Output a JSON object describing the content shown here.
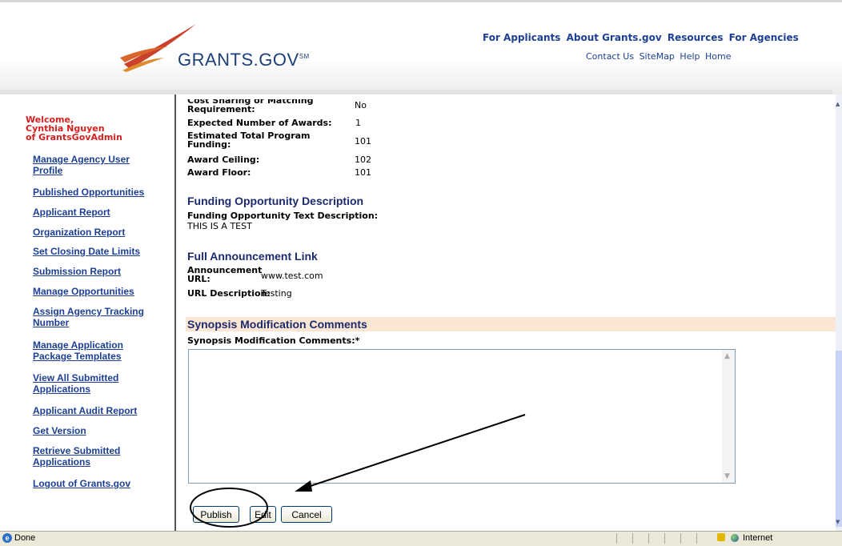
{
  "header": {
    "logo_text": "GRANTS.GOV",
    "logo_mark": "SM",
    "top_nav": [
      "For Applicants",
      "About Grants.gov",
      "Resources",
      "For Agencies"
    ],
    "sub_nav": [
      "Contact Us",
      "SiteMap",
      "Help",
      "Home"
    ]
  },
  "sidebar": {
    "welcome": [
      "Welcome,",
      "Cynthia Nguyen",
      "of GrantsGovAdmin"
    ],
    "links": [
      [
        "Manage Agency User",
        "Profile"
      ],
      [
        "Published Opportunities"
      ],
      [
        "Applicant Report"
      ],
      [
        "Organization Report"
      ],
      [
        "Set Closing Date Limits"
      ],
      [
        "Submission Report"
      ],
      [
        "Manage Opportunities"
      ],
      [
        "Assign Agency Tracking",
        "Number"
      ],
      [
        "Manage Application",
        "Package Templates"
      ],
      [
        "View All Submitted",
        "Applications"
      ],
      [
        "Applicant Audit Report"
      ],
      [
        "Get Version"
      ],
      [
        "Retrieve Submitted",
        "Applications"
      ],
      [
        "Logout of Grants.gov"
      ]
    ]
  },
  "funding": {
    "cost_sharing_label_1": "Cost Sharing or Matching",
    "cost_sharing_label_2": "Requirement:",
    "cost_sharing_value": "No",
    "expected_awards_label": "Expected Number of Awards:",
    "expected_awards_value": "1",
    "total_funding_label_1": "Estimated Total Program",
    "total_funding_label_2": "Funding:",
    "total_funding_value": "101",
    "award_ceiling_label": "Award Ceiling:",
    "award_ceiling_value": "102",
    "award_floor_label": "Award Floor:",
    "award_floor_value": "101"
  },
  "description": {
    "title": "Funding Opportunity Description",
    "text_label": "Funding Opportunity Text Description:",
    "text_value": "THIS IS A TEST"
  },
  "announcement": {
    "title": "Full Announcement Link",
    "url_label_1": "Announcement",
    "url_label_2": "URL:",
    "url_value": "www.test.com",
    "desc_label": "URL Description:",
    "desc_value": "Testing"
  },
  "synopsis": {
    "title": "Synopsis Modification Comments",
    "field_label": "Synopsis Modification Comments:*",
    "value": ""
  },
  "buttons": {
    "publish": "Publish",
    "edit": "Edit",
    "cancel": "Cancel"
  },
  "statusbar": {
    "status": "Done",
    "zone": "Internet"
  },
  "colors": {
    "nav_blue": "#1c3f94",
    "welcome_red": "#d61e1e",
    "synopsis_bg": "#fae6d2"
  }
}
